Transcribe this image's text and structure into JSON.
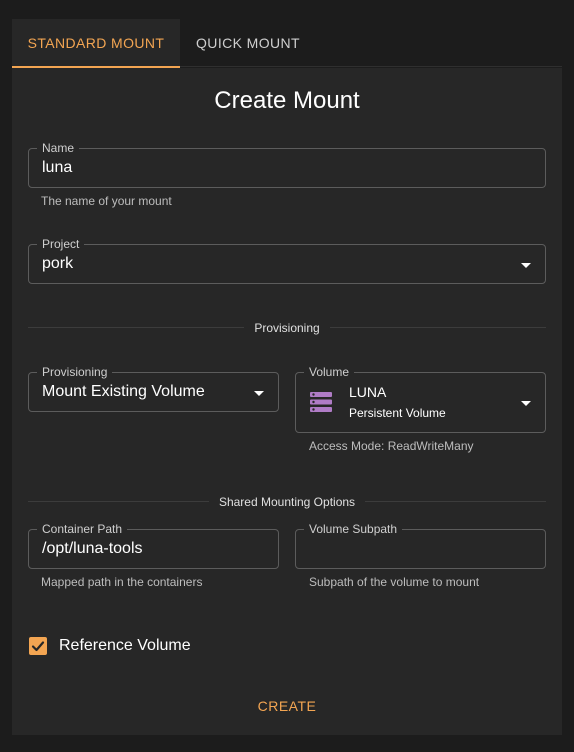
{
  "tabs": [
    {
      "label": "STANDARD MOUNT",
      "active": true
    },
    {
      "label": "QUICK MOUNT",
      "active": false
    }
  ],
  "form": {
    "title": "Create Mount",
    "name": {
      "label": "Name",
      "value": "luna",
      "helper": "The name of your mount"
    },
    "project": {
      "label": "Project",
      "value": "pork"
    },
    "provisioning_section": "Provisioning",
    "provisioning": {
      "label": "Provisioning",
      "value": "Mount Existing Volume"
    },
    "volume": {
      "label": "Volume",
      "name": "LUNA",
      "type": "Persistent Volume",
      "helper": "Access Mode: ReadWriteMany",
      "icon": "storage-icon"
    },
    "shared_section": "Shared Mounting Options",
    "container_path": {
      "label": "Container Path",
      "value": "/opt/luna-tools",
      "helper": "Mapped path in the containers"
    },
    "volume_subpath": {
      "label": "Volume Subpath",
      "value": "",
      "helper": "Subpath of the volume to mount"
    },
    "reference_volume": {
      "label": "Reference Volume",
      "checked": true
    },
    "submit_label": "CREATE"
  },
  "colors": {
    "accent": "#f3a552",
    "volume_icon": "#b07cc6",
    "background": "#1c1c1c",
    "card": "#272727"
  }
}
